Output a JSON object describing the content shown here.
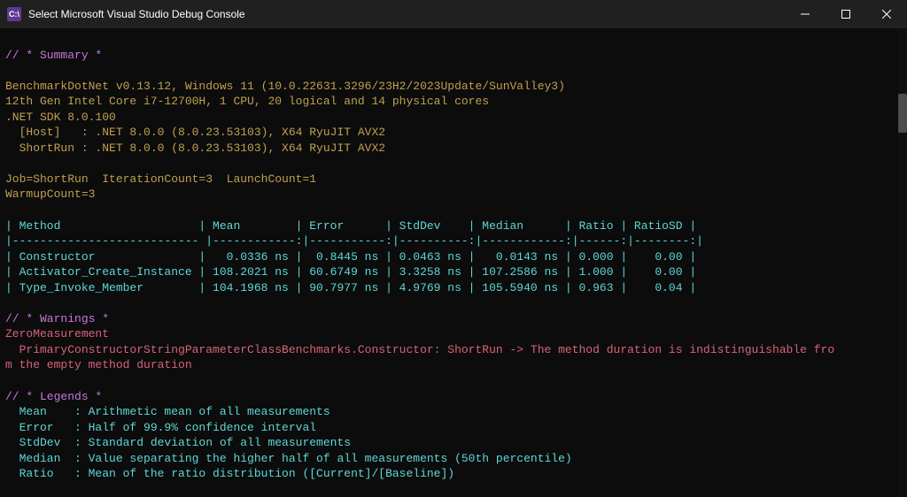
{
  "titlebar": {
    "icon_label": "C:\\",
    "title": "Select Microsoft Visual Studio Debug Console"
  },
  "summary": {
    "header": "// * Summary *",
    "env1": "BenchmarkDotNet v0.13.12, Windows 11 (10.0.22631.3296/23H2/2023Update/SunValley3)",
    "env2": "12th Gen Intel Core i7-12700H, 1 CPU, 20 logical and 14 physical cores",
    "env3": ".NET SDK 8.0.100",
    "env4": "  [Host]   : .NET 8.0.0 (8.0.23.53103), X64 RyuJIT AVX2",
    "env5": "  ShortRun : .NET 8.0.0 (8.0.23.53103), X64 RyuJIT AVX2",
    "job": "Job=ShortRun  IterationCount=3  LaunchCount=1\nWarmupCount=3"
  },
  "table": {
    "headers": [
      "Method",
      "Mean",
      "Error",
      "StdDev",
      "Median",
      "Ratio",
      "RatioSD"
    ],
    "rows": [
      {
        "method": "Constructor",
        "mean": "0.0336 ns",
        "error": "0.8445 ns",
        "stddev": "0.0463 ns",
        "median": "0.0143 ns",
        "ratio": "0.000",
        "ratiosd": "0.00"
      },
      {
        "method": "Activator_Create_Instance",
        "mean": "108.2021 ns",
        "error": "60.6749 ns",
        "stddev": "3.3258 ns",
        "median": "107.2586 ns",
        "ratio": "1.000",
        "ratiosd": "0.00"
      },
      {
        "method": "Type_Invoke_Member",
        "mean": "104.1968 ns",
        "error": "90.7977 ns",
        "stddev": "4.9769 ns",
        "median": "105.5940 ns",
        "ratio": "0.963",
        "ratiosd": "0.04"
      }
    ]
  },
  "warnings": {
    "header": "// * Warnings *",
    "title": "ZeroMeasurement",
    "msg": "  PrimaryConstructorStringParameterClassBenchmarks.Constructor: ShortRun -> The method duration is indistinguishable fro\nm the empty method duration"
  },
  "legends": {
    "header": "// * Legends *",
    "items": [
      {
        "term": "Mean",
        "desc": "Arithmetic mean of all measurements"
      },
      {
        "term": "Error",
        "desc": "Half of 99.9% confidence interval"
      },
      {
        "term": "StdDev",
        "desc": "Standard deviation of all measurements"
      },
      {
        "term": "Median",
        "desc": "Value separating the higher half of all measurements (50th percentile)"
      },
      {
        "term": "Ratio",
        "desc": "Mean of the ratio distribution ([Current]/[Baseline])"
      }
    ]
  }
}
